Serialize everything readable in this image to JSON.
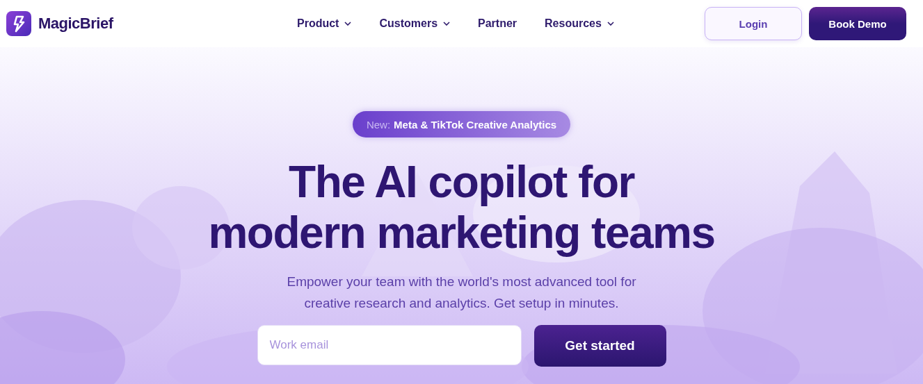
{
  "brand": {
    "name": "MagicBrief"
  },
  "nav": [
    {
      "label": "Product",
      "has_menu": true
    },
    {
      "label": "Customers",
      "has_menu": true
    },
    {
      "label": "Partner",
      "has_menu": false
    },
    {
      "label": "Resources",
      "has_menu": true
    }
  ],
  "actions": {
    "login": "Login",
    "demo": "Book Demo"
  },
  "hero": {
    "badge": {
      "prefix": "New:",
      "text": "Meta & TikTok Creative Analytics"
    },
    "headline": [
      "The AI copilot for",
      "modern marketing teams"
    ],
    "subtitle": [
      "Empower your team with the world's most advanced tool for",
      "creative research and analytics. Get setup in minutes."
    ],
    "email": {
      "placeholder": "Work email"
    },
    "cta": "Get started"
  }
}
